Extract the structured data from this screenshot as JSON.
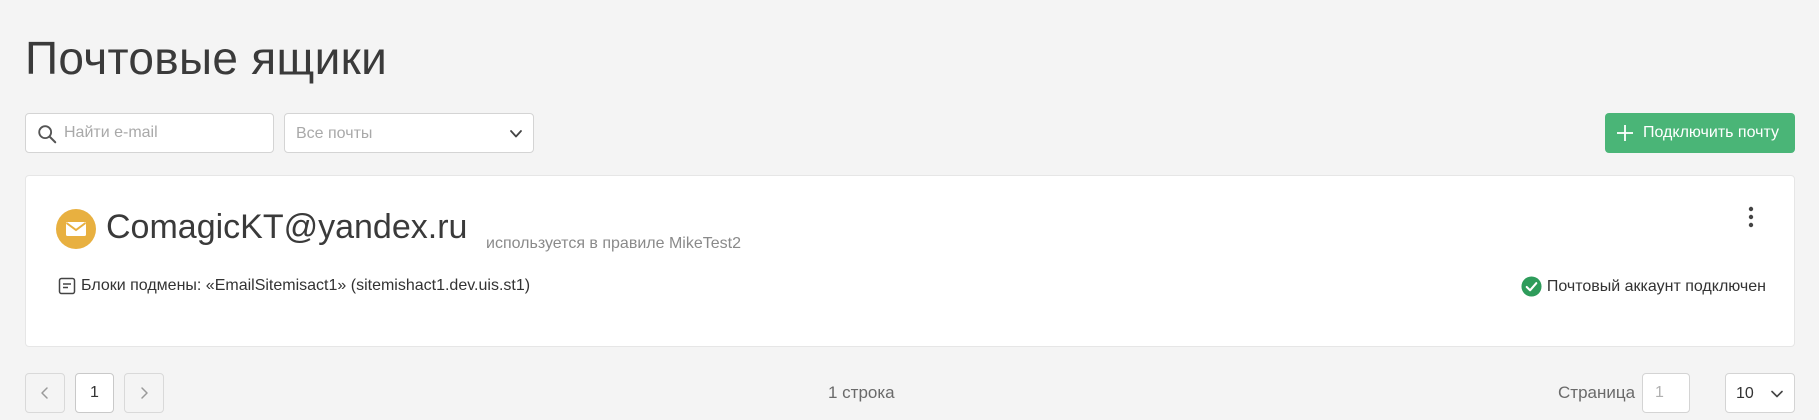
{
  "header": {
    "title": "Почтовые ящики"
  },
  "toolbar": {
    "search_placeholder": "Найти e-mail",
    "filter_value": "Все почты",
    "connect_label": "Подключить почту"
  },
  "mailbox": {
    "email": "ComagicKT@yandex.ru",
    "rule_note": "используется в правиле MikeTest2",
    "blocks": "Блоки подмены: «EmailSitemisact1» (sitemishact1.dev.uis.st1)",
    "status": "Почтовый аккаунт подключен"
  },
  "pagination": {
    "current_page": "1",
    "rows_count": "1 строка",
    "page_label": "Страница",
    "page_input_placeholder": "1",
    "page_size": "10"
  },
  "colors": {
    "accent_green": "#4ab577",
    "mail_icon": "#e8b040",
    "status_ok": "#2e9c5b"
  },
  "icons": {
    "search": "search-icon",
    "dropdown": "chevron-down-icon",
    "add": "plus-icon",
    "mail": "mail-icon",
    "menu": "more-vertical-icon",
    "blocks": "document-icon",
    "status": "check-circle-icon",
    "prev": "chevron-left-icon",
    "next": "chevron-right-icon"
  }
}
